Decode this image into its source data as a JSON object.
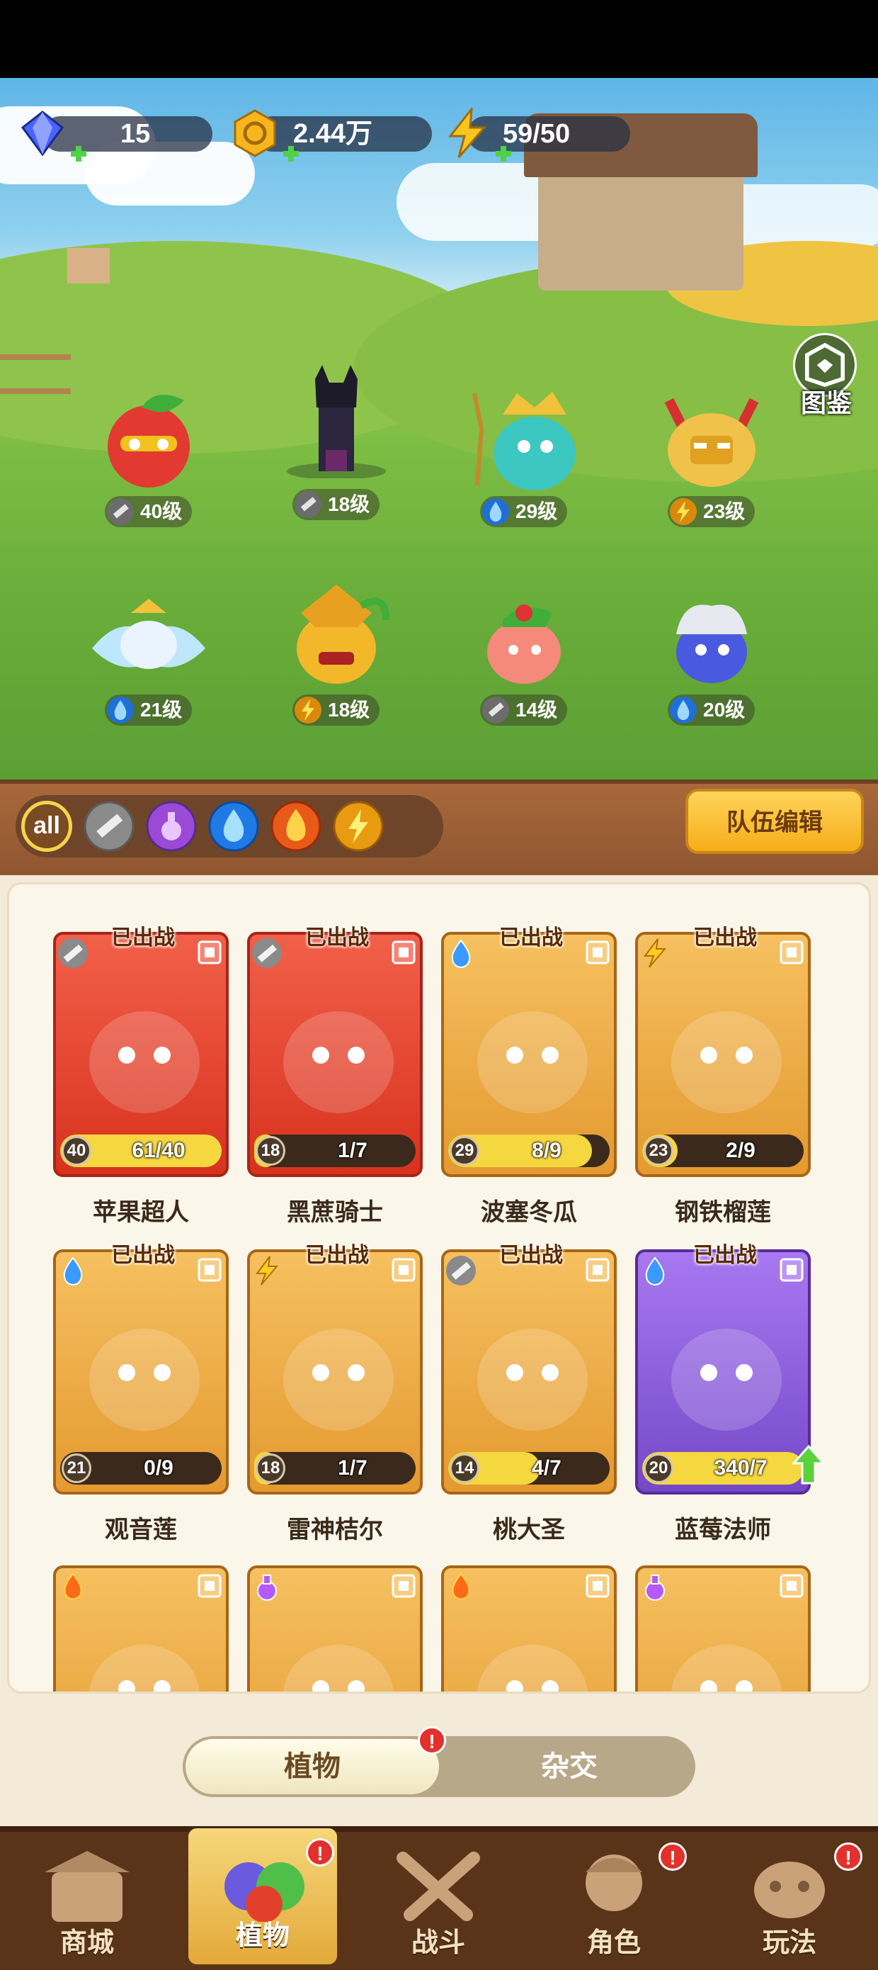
{
  "resources": {
    "gems": "15",
    "gold": "2.44万",
    "energy": "59/50"
  },
  "codex_label": "图鉴",
  "team_lineup": [
    {
      "level": "40级",
      "element": "sword"
    },
    {
      "level": "18级",
      "element": "sword"
    },
    {
      "level": "29级",
      "element": "water"
    },
    {
      "level": "23级",
      "element": "lightning"
    },
    {
      "level": "21级",
      "element": "water"
    },
    {
      "level": "18级",
      "element": "lightning"
    },
    {
      "level": "14级",
      "element": "sword"
    },
    {
      "level": "20级",
      "element": "water"
    }
  ],
  "filters": {
    "all_label": "all",
    "items": [
      "all",
      "sword",
      "poison",
      "water",
      "fire",
      "lightning"
    ]
  },
  "team_edit_label": "队伍编辑",
  "deployed_badge": "已出战",
  "cards": [
    {
      "name": "苹果超人",
      "level": "40",
      "count": "61/40",
      "progress": 1.0,
      "element": "sword",
      "theme": "red"
    },
    {
      "name": "黑蔗骑士",
      "level": "18",
      "count": "1/7",
      "progress": 0.14,
      "element": "sword",
      "theme": "red"
    },
    {
      "name": "波塞冬瓜",
      "level": "29",
      "count": "8/9",
      "progress": 0.89,
      "element": "water",
      "theme": "gold"
    },
    {
      "name": "钢铁榴莲",
      "level": "23",
      "count": "2/9",
      "progress": 0.22,
      "element": "lightning",
      "theme": "gold"
    },
    {
      "name": "观音莲",
      "level": "21",
      "count": "0/9",
      "progress": 0.0,
      "element": "water",
      "theme": "gold"
    },
    {
      "name": "雷神桔尔",
      "level": "18",
      "count": "1/7",
      "progress": 0.14,
      "element": "lightning",
      "theme": "gold"
    },
    {
      "name": "桃大圣",
      "level": "14",
      "count": "4/7",
      "progress": 0.57,
      "element": "sword",
      "theme": "gold"
    },
    {
      "name": "蓝莓法师",
      "level": "20",
      "count": "340/7",
      "progress": 1.0,
      "element": "water",
      "theme": "purple"
    }
  ],
  "partial_cards": [
    {
      "element": "fire",
      "theme": "gold"
    },
    {
      "element": "poison",
      "theme": "gold"
    },
    {
      "element": "fire",
      "theme": "gold"
    },
    {
      "element": "poison",
      "theme": "gold"
    }
  ],
  "segment": {
    "plant": "植物",
    "crossbreed": "杂交"
  },
  "nav": [
    {
      "label": "商城",
      "icon": "shop-icon",
      "selected": false,
      "alert": false
    },
    {
      "label": "植物",
      "icon": "plants-icon",
      "selected": true,
      "alert": true
    },
    {
      "label": "战斗",
      "icon": "battle-icon",
      "selected": false,
      "alert": false
    },
    {
      "label": "角色",
      "icon": "character-icon",
      "selected": false,
      "alert": true
    },
    {
      "label": "玩法",
      "icon": "gameplay-icon",
      "selected": false,
      "alert": true
    }
  ],
  "alert_mark": "!",
  "colors": {
    "accent_gold": "#f6ad1a",
    "card_red": "#e84a3a",
    "card_gold": "#e9a83a",
    "card_purple": "#8a58d6",
    "progress_yellow": "#f5d740",
    "wood": "#8e5530"
  }
}
